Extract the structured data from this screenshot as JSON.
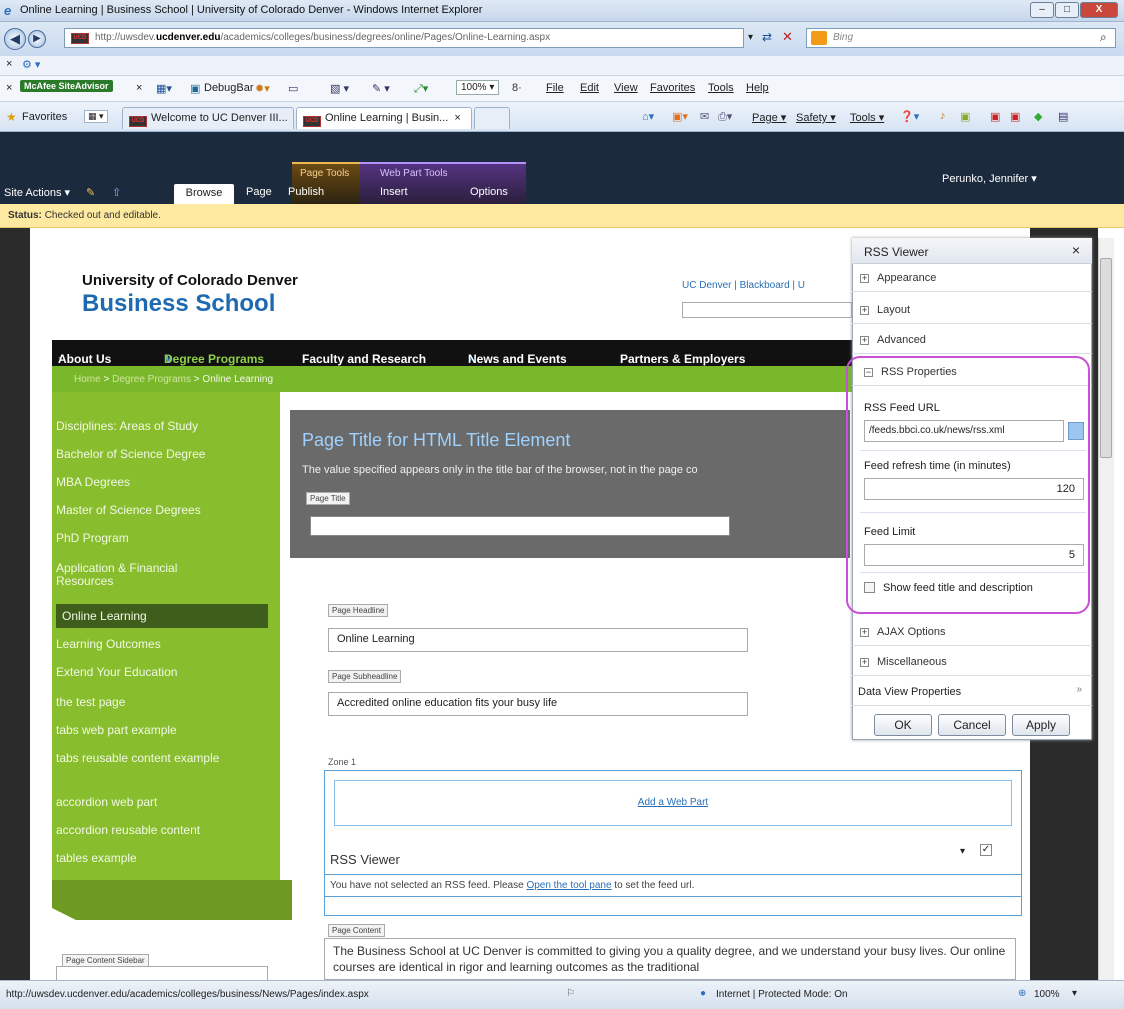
{
  "window": {
    "title": "Online Learning | Business School | University of Colorado Denver - Windows Internet Explorer",
    "controls": [
      "–",
      "□",
      "X"
    ]
  },
  "addressbar": {
    "url_prefix": "http://uwsdev.",
    "url_domain": "ucdenver.edu",
    "url_path": "/academics/colleges/business/degrees/online/Pages/Online-Learning.aspx",
    "search_placeholder": "Bing"
  },
  "toolbar": {
    "mcafee": "McAfee SiteAdvisor",
    "debugbar": "DebugBar",
    "zoom": "100%",
    "menus": [
      "File",
      "Edit",
      "View",
      "Favorites",
      "Tools",
      "Help"
    ]
  },
  "favbar": {
    "favorites": "Favorites",
    "tab1": "Welcome to UC Denver III...",
    "tab2": "Online Learning | Busin...",
    "tools": [
      "Page",
      "Safety",
      "Tools"
    ]
  },
  "ribbon": {
    "site_actions": "Site Actions",
    "tabs": [
      "Browse",
      "Page",
      "Publish",
      "Insert",
      "Options"
    ],
    "ctx1": "Page Tools",
    "ctx2": "Web Part Tools",
    "user": "Perunko, Jennifer"
  },
  "status": {
    "label": "Status:",
    "text": "Checked out and editable."
  },
  "site": {
    "org": "University of Colorado Denver",
    "school": "Business School",
    "toplinks": "UC Denver | Blackboard | U",
    "nav": [
      "About Us",
      "Degree Programs",
      "Faculty and Research",
      "News and Events",
      "Partners & Employers"
    ],
    "breadcrumb": {
      "home": "Home",
      "sep": " > ",
      "degrees": "Degree Programs",
      "current": "Online Learning"
    },
    "leftnav": [
      "Disciplines: Areas of Study",
      "Bachelor of Science Degree",
      "MBA Degrees",
      "Master of Science Degrees",
      "PhD Program",
      "Application & Financial Resources",
      "Online Learning",
      "Learning Outcomes",
      "Extend Your Education",
      "the test page",
      "tabs web part example",
      "tabs reusable content example",
      "accordion web part",
      "accordion reusable content",
      "tables example"
    ],
    "sidebar_label": "Page Content Sidebar"
  },
  "editor": {
    "title_heading": "Page Title for HTML Title Element",
    "title_desc": "The value specified appears only in the title bar of the browser, not in the page co",
    "title_label": "Page Title",
    "headline_label": "Page Headline",
    "headline_value": "Online Learning",
    "subheadline_label": "Page Subheadline",
    "subheadline_value": "Accredited online education fits your busy life",
    "zone_label": "Zone 1",
    "add_webpart": "Add a Web Part",
    "rss_title": "RSS Viewer",
    "rss_msg_pre": "You have not selected an RSS feed. Please ",
    "rss_msg_link": "Open the tool pane",
    "rss_msg_post": " to set the feed url.",
    "content_label": "Page Content",
    "content_text": "The Business School at UC Denver is committed to giving you a quality degree, and we understand your busy lives. Our online courses are identical in rigor and learning outcomes as the traditional"
  },
  "toolpane": {
    "title": "RSS Viewer",
    "close": "×",
    "sections": [
      "Appearance",
      "Layout",
      "Advanced",
      "RSS Properties",
      "AJAX Options",
      "Miscellaneous"
    ],
    "feed_url_label": "RSS Feed URL",
    "feed_url_value": "/feeds.bbci.co.uk/news/rss.xml",
    "refresh_label": "Feed refresh time (in minutes)",
    "refresh_value": "120",
    "limit_label": "Feed Limit",
    "limit_value": "5",
    "show_title_label": "Show feed title and description",
    "data_view": "Data View Properties",
    "buttons": [
      "OK",
      "Cancel",
      "Apply"
    ]
  },
  "iestatus": {
    "url": "http://uwsdev.ucdenver.edu/academics/colleges/business/News/Pages/index.aspx",
    "zone": "Internet | Protected Mode: On",
    "zoom": "100%"
  }
}
